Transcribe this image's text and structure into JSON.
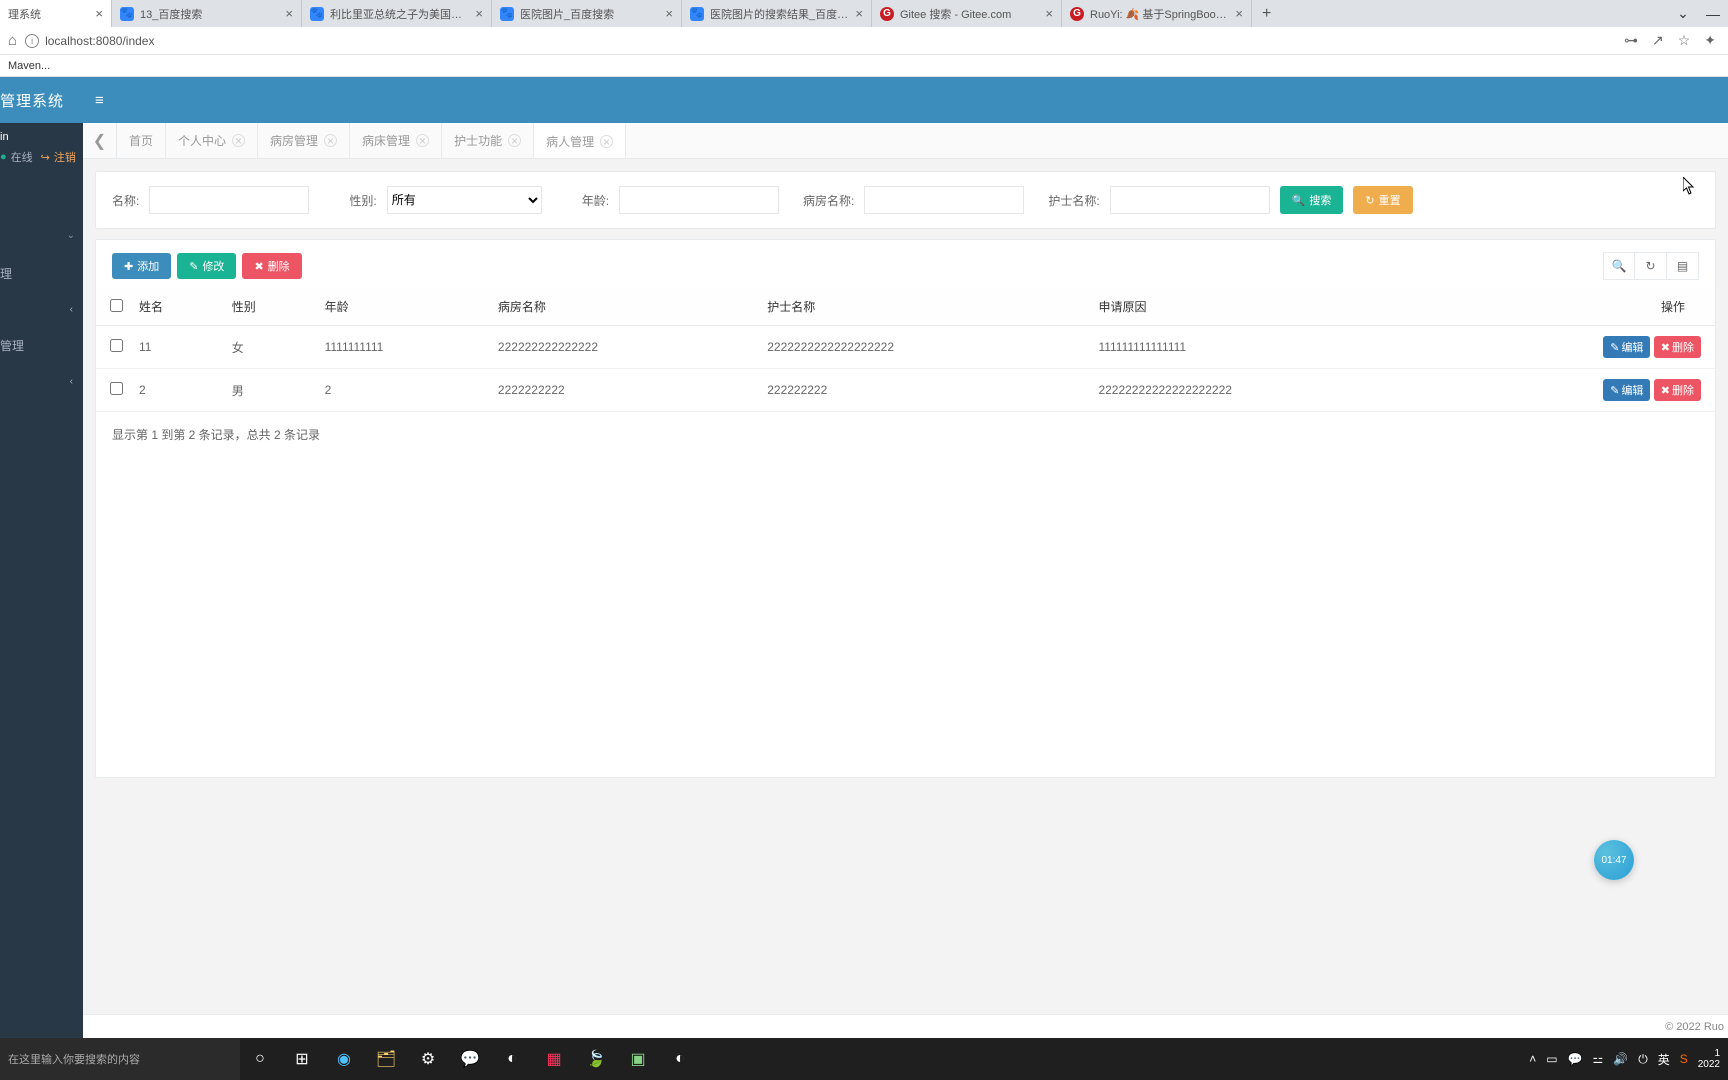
{
  "browser": {
    "tabs": [
      {
        "label": "理系统",
        "active": true,
        "favicon": ""
      },
      {
        "label": "13_百度搜索",
        "favicon": "baidu"
      },
      {
        "label": "利比里亚总统之子为美国队破门",
        "favicon": "baidu"
      },
      {
        "label": "医院图片_百度搜索",
        "favicon": "baidu"
      },
      {
        "label": "医院图片的搜索结果_百度图片",
        "favicon": "baidu"
      },
      {
        "label": "Gitee 搜索 - Gitee.com",
        "favicon": "gitee"
      },
      {
        "label": "RuoYi: 🍂 基于SpringBoot的",
        "favicon": "gitee"
      }
    ],
    "url": "localhost:8080/index",
    "bookmarks": [
      "Maven..."
    ]
  },
  "sidebar": {
    "title": "管理系统",
    "user": "in",
    "status_online": "在线",
    "status_logout": "注销",
    "items": [
      "理",
      "管理"
    ]
  },
  "topbar": {},
  "apptabs": [
    {
      "label": "首页",
      "closable": false
    },
    {
      "label": "个人中心",
      "closable": true
    },
    {
      "label": "病房管理",
      "closable": true
    },
    {
      "label": "病床管理",
      "closable": true
    },
    {
      "label": "护士功能",
      "closable": true
    },
    {
      "label": "病人管理",
      "closable": true,
      "active": true
    }
  ],
  "searchform": {
    "name_label": "名称:",
    "gender_label": "性别:",
    "gender_value": "所有",
    "age_label": "年龄:",
    "ward_label": "病房名称:",
    "nurse_label": "护士名称:",
    "search_btn": "搜索",
    "reset_btn": "重置"
  },
  "toolbar": {
    "add": "添加",
    "mod": "修改",
    "del": "删除"
  },
  "table": {
    "headers": [
      "",
      "姓名",
      "性别",
      "年龄",
      "病房名称",
      "护士名称",
      "申请原因",
      "操作"
    ],
    "rows": [
      {
        "name": "11",
        "gender": "女",
        "age": "1111111111",
        "ward": "222222222222222",
        "nurse": "2222222222222222222",
        "reason": "111111111111111"
      },
      {
        "name": "2",
        "gender": "男",
        "age": "2",
        "ward": "2222222222",
        "nurse": "222222222",
        "reason": "22222222222222222222"
      }
    ],
    "edit_btn": "编辑",
    "del_btn": "删除"
  },
  "pager": "显示第 1 到第 2 条记录，总共 2 条记录",
  "footer": "© 2022 Ruo",
  "timer": "01:47",
  "taskbar": {
    "search_placeholder": "在这里输入你要搜索的内容",
    "ime": "英",
    "time": "1",
    "date": "2022"
  }
}
